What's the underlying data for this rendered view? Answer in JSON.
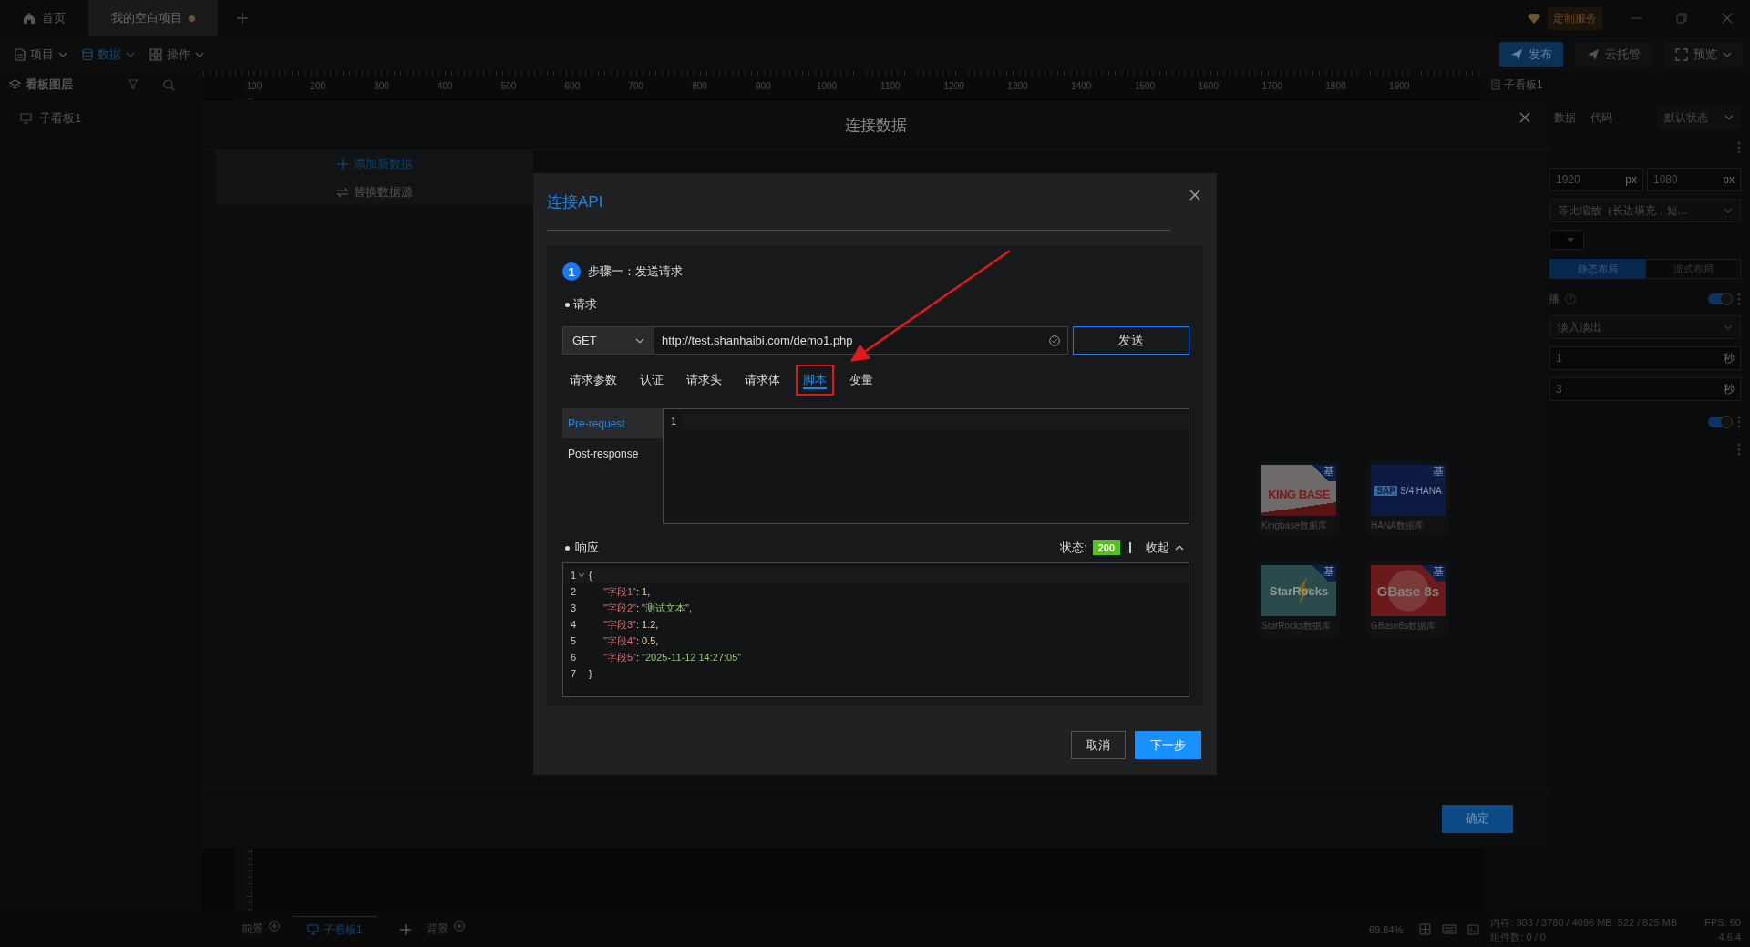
{
  "app_tabs": [
    {
      "label": "首页",
      "kind": "home",
      "selected": false,
      "unsaved": false
    },
    {
      "label": "我的空白项目",
      "kind": "project",
      "selected": true,
      "unsaved": true
    }
  ],
  "service_button": "定制服务",
  "menus": [
    {
      "label": "项目",
      "kind": "file",
      "selected": false
    },
    {
      "label": "数据",
      "kind": "database",
      "selected": true
    },
    {
      "label": "操作",
      "kind": "grid",
      "selected": false
    }
  ],
  "actions": [
    {
      "label": "发布",
      "kind": "send",
      "primary": true
    },
    {
      "label": "云托管",
      "kind": "send",
      "primary": false
    },
    {
      "label": "预览",
      "kind": "fullscreen",
      "primary": false
    }
  ],
  "layers_panel": {
    "title": "看板图层",
    "items": [
      "子看板1"
    ]
  },
  "ruler": {
    "ticks": [
      "100",
      "200",
      "300",
      "400",
      "500",
      "600",
      "700",
      "800",
      "900",
      "1000",
      "1100",
      "1200",
      "1300",
      "1400",
      "1500",
      "1600",
      "1700",
      "1800",
      "1900"
    ]
  },
  "right_panel": {
    "board_title": "子看板1",
    "tabs": [
      "数据",
      "代码"
    ],
    "state_select": "默认状态",
    "size": [
      {
        "value": "1920",
        "unit": "px"
      },
      {
        "value": "1080",
        "unit": "px"
      }
    ],
    "scale_select": "等比缩放（长边填充，短...",
    "layout_modes": [
      {
        "label": "静态布局",
        "selected": true
      },
      {
        "label": "流式布局",
        "selected": false
      }
    ],
    "carousel": {
      "label": "播",
      "on": true
    },
    "transition_select": "淡入淡出",
    "durations": [
      {
        "value": "1",
        "unit": "秒"
      },
      {
        "value": "3",
        "unit": "秒"
      }
    ],
    "second_toggle": {
      "on": true
    }
  },
  "bottom_bar": {
    "foreground": "前景",
    "boards": [
      {
        "label": "子看板1",
        "selected": true
      }
    ],
    "background": "背景",
    "zoom": "69.84%",
    "memory": "内存: 303 / 3780 / 4096 MB",
    "gpu_memory": "522 / 825 MB",
    "fps": "FPS: 60",
    "components": "组件数: 0 / 0",
    "version": "4.6.4"
  },
  "data_modal": {
    "title": "连接数据",
    "add_button": "添加新数据",
    "replace_button": "替换数据源",
    "sources": [
      {
        "label": "Kingbase数据库",
        "kind": "kingbase",
        "logo": "KING BASE",
        "badge": "基"
      },
      {
        "label": "HANA数据库",
        "kind": "hana",
        "logo": "S/4 HANA",
        "logo_sub": "SAP",
        "badge": "基"
      },
      {
        "label": "StarRocks数据库",
        "kind": "starrocks",
        "logo": "StarRocks",
        "badge": "基"
      },
      {
        "label": "GBase8s数据库",
        "kind": "gbase",
        "logo": "GBase 8s",
        "badge": "基"
      }
    ],
    "confirm": "确定"
  },
  "api_dialog": {
    "title": "连接API",
    "step_number": "1",
    "step_label": "步骤一：发送请求",
    "request_label": "请求",
    "method": "GET",
    "url": "http://test.shanhaibi.com/demo1.php",
    "send": "发送",
    "tabs": [
      {
        "label": "请求参数",
        "selected": false,
        "highlighted": false
      },
      {
        "label": "认证",
        "selected": false,
        "highlighted": false
      },
      {
        "label": "请求头",
        "selected": false,
        "highlighted": false
      },
      {
        "label": "请求体",
        "selected": false,
        "highlighted": false
      },
      {
        "label": "脚本",
        "selected": true,
        "highlighted": true
      },
      {
        "label": "变量",
        "selected": false,
        "highlighted": false
      }
    ],
    "script_tabs": [
      {
        "label": "Pre-request",
        "selected": true
      },
      {
        "label": "Post-response",
        "selected": false
      }
    ],
    "editor_lines": [
      "1"
    ],
    "response_label": "响应",
    "status_label": "状态:",
    "status": "200",
    "collapse": "收起",
    "response_lines": [
      {
        "number": "1",
        "foldable": true,
        "tokens": [
          {
            "text": "{",
            "kind": "punct"
          }
        ]
      },
      {
        "number": "2",
        "foldable": false,
        "tokens": [
          {
            "text": "\"字段1\"",
            "kind": "key"
          },
          {
            "text": ": ",
            "kind": "punct"
          },
          {
            "text": "1",
            "kind": "number"
          },
          {
            "text": ",",
            "kind": "punct"
          }
        ]
      },
      {
        "number": "3",
        "foldable": false,
        "tokens": [
          {
            "text": "\"字段2\"",
            "kind": "key"
          },
          {
            "text": ": ",
            "kind": "punct"
          },
          {
            "text": "\"测试文本\"",
            "kind": "string"
          },
          {
            "text": ",",
            "kind": "punct"
          }
        ]
      },
      {
        "number": "4",
        "foldable": false,
        "tokens": [
          {
            "text": "\"字段3\"",
            "kind": "key"
          },
          {
            "text": ": ",
            "kind": "punct"
          },
          {
            "text": "1.2",
            "kind": "number"
          },
          {
            "text": ",",
            "kind": "punct"
          }
        ]
      },
      {
        "number": "5",
        "foldable": false,
        "tokens": [
          {
            "text": "\"字段4\"",
            "kind": "key"
          },
          {
            "text": ": ",
            "kind": "punct"
          },
          {
            "text": "0.5",
            "kind": "number"
          },
          {
            "text": ",",
            "kind": "punct"
          }
        ]
      },
      {
        "number": "6",
        "foldable": false,
        "tokens": [
          {
            "text": "\"字段5\"",
            "kind": "key"
          },
          {
            "text": ": ",
            "kind": "punct"
          },
          {
            "text": "\"2025-11-12 14:27:05\"",
            "kind": "string"
          }
        ]
      },
      {
        "number": "7",
        "foldable": false,
        "tokens": [
          {
            "text": "}",
            "kind": "punct"
          }
        ]
      }
    ],
    "cancel": "取消",
    "next": "下一步"
  }
}
